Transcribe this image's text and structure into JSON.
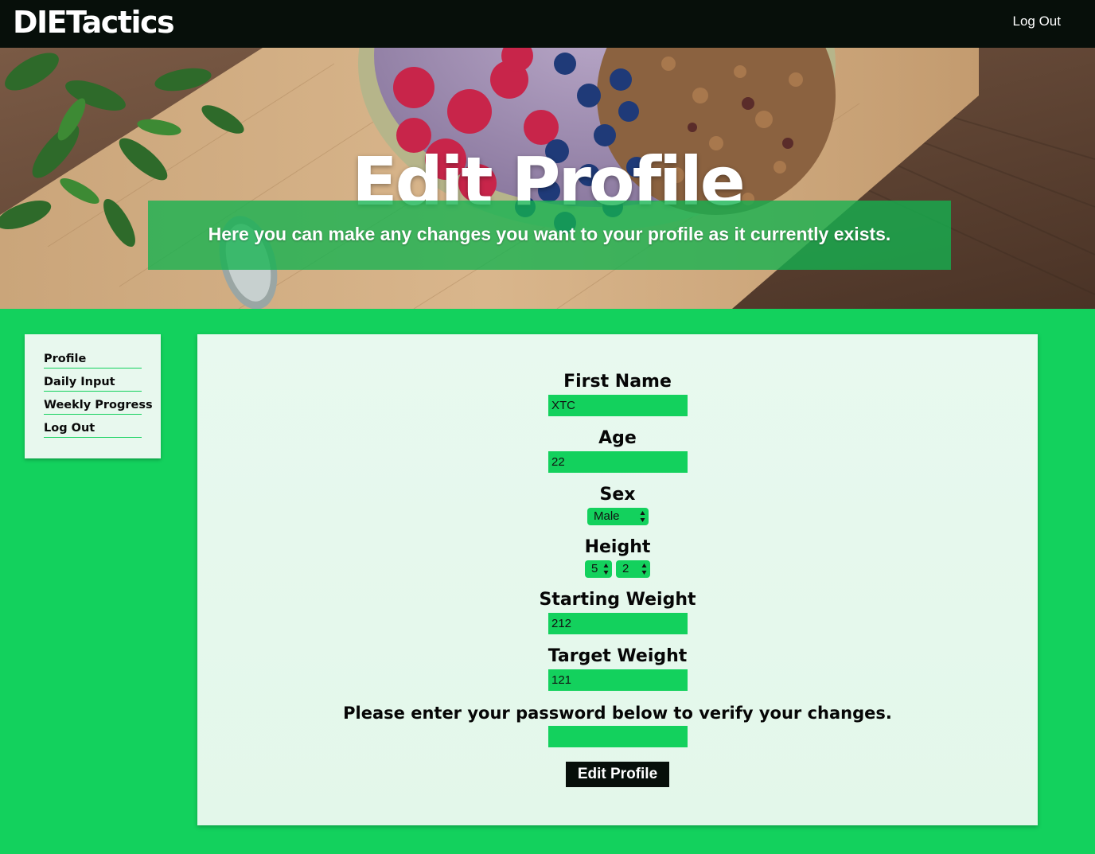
{
  "navbar": {
    "brand": "DIETactics",
    "logout_label": "Log Out"
  },
  "hero": {
    "title": "Edit Profile",
    "subtitle": "Here you can make any changes you want to your profile as it currently exists."
  },
  "sidebar": {
    "items": [
      {
        "label": "Profile"
      },
      {
        "label": "Daily Input"
      },
      {
        "label": "Weekly Progress"
      },
      {
        "label": "Log Out"
      }
    ]
  },
  "form": {
    "first_name": {
      "label": "First Name",
      "value": "XTC"
    },
    "age": {
      "label": "Age",
      "value": "22"
    },
    "sex": {
      "label": "Sex",
      "value": "Male"
    },
    "height": {
      "label": "Height",
      "feet": "5",
      "inches": "2"
    },
    "starting_weight": {
      "label": "Starting Weight",
      "value": "212"
    },
    "target_weight": {
      "label": "Target Weight",
      "value": "121"
    },
    "password": {
      "prompt": "Please enter your password below to verify your changes.",
      "value": ""
    },
    "submit_label": "Edit Profile"
  },
  "colors": {
    "accent": "#13d15d",
    "dark": "#070f0a",
    "card": "#e8f8ee"
  }
}
